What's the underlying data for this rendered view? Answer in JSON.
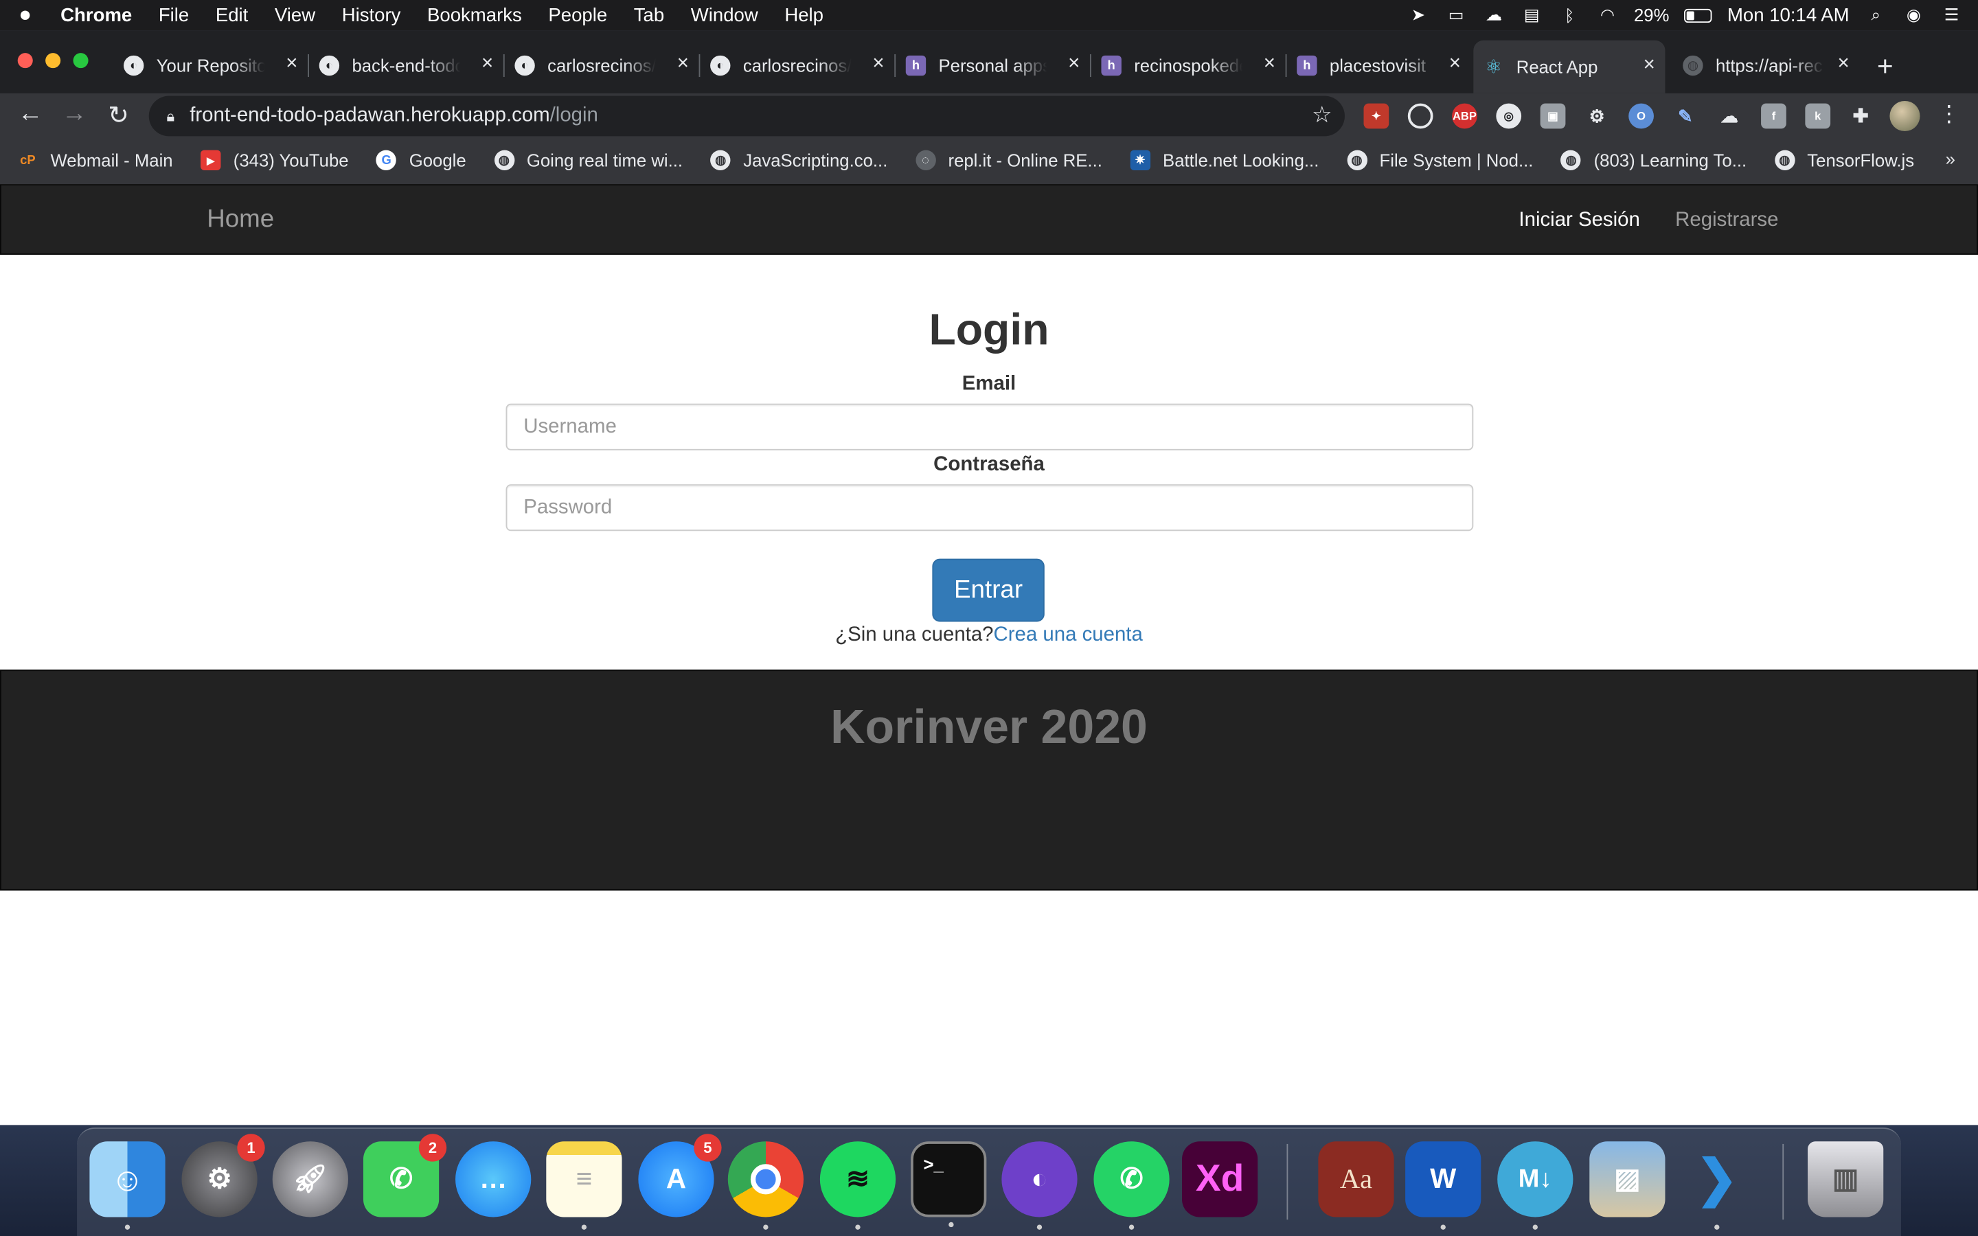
{
  "menubar": {
    "app_name": "Chrome",
    "items": [
      "File",
      "Edit",
      "View",
      "History",
      "Bookmarks",
      "People",
      "Tab",
      "Window",
      "Help"
    ],
    "battery_percent": "29%",
    "clock": "Mon 10:14 AM"
  },
  "browser": {
    "tabs": [
      {
        "title": "Your Repositories",
        "icon": "github-icon"
      },
      {
        "title": "back-end-todo",
        "icon": "github-icon"
      },
      {
        "title": "carlosrecinos/",
        "icon": "github-icon"
      },
      {
        "title": "carlosrecinos/",
        "icon": "github-icon"
      },
      {
        "title": "Personal apps",
        "icon": "heroku-icon"
      },
      {
        "title": "recinospokedex",
        "icon": "heroku-icon"
      },
      {
        "title": "placestovisit",
        "icon": "heroku-icon"
      },
      {
        "title": "React App",
        "icon": "react-icon",
        "active": true
      },
      {
        "title": "https://api-recinos",
        "icon": "globe-icon"
      }
    ],
    "address": {
      "host": "front-end-todo-padawan.herokuapp.com",
      "path": "/login"
    },
    "bookmarks": [
      {
        "label": "Webmail - Main",
        "icon": "cpanel-icon"
      },
      {
        "label": "(343) YouTube",
        "icon": "youtube-icon"
      },
      {
        "label": "Google",
        "icon": "google-icon"
      },
      {
        "label": "Going real time wi...",
        "icon": "globe-icon"
      },
      {
        "label": "JavaScripting.co...",
        "icon": "globe-icon"
      },
      {
        "label": "repl.it - Online RE...",
        "icon": "replit-icon"
      },
      {
        "label": "Battle.net Looking...",
        "icon": "battlenet-icon"
      },
      {
        "label": "File System | Nod...",
        "icon": "globe-icon"
      },
      {
        "label": "(803) Learning To...",
        "icon": "globe-icon"
      },
      {
        "label": "TensorFlow.js",
        "icon": "globe-icon"
      }
    ],
    "bookmarks_more": "»"
  },
  "site": {
    "nav": {
      "brand": "Home",
      "login": "Iniciar Sesión",
      "register": "Registrarse"
    },
    "login": {
      "title": "Login",
      "email_label": "Email",
      "email_placeholder": "Username",
      "password_label": "Contraseña",
      "password_placeholder": "Password",
      "submit": "Entrar",
      "signup_prompt": "¿Sin una cuenta?",
      "signup_link": "Crea una cuenta"
    },
    "footer": "Korinver 2020"
  },
  "dock": {
    "apps": [
      {
        "name": "Finder",
        "badge": ""
      },
      {
        "name": "System Preferences",
        "badge": "1"
      },
      {
        "name": "Launchpad",
        "badge": ""
      },
      {
        "name": "FaceTime",
        "badge": "2"
      },
      {
        "name": "Messages",
        "badge": ""
      },
      {
        "name": "Notes",
        "badge": ""
      },
      {
        "name": "App Store",
        "badge": "5"
      },
      {
        "name": "Chrome",
        "badge": ""
      },
      {
        "name": "Spotify",
        "badge": ""
      },
      {
        "name": "Terminal",
        "badge": ""
      },
      {
        "name": "GitHub Desktop",
        "badge": ""
      },
      {
        "name": "WhatsApp",
        "badge": ""
      },
      {
        "name": "Adobe XD",
        "badge": ""
      },
      {
        "name": "Dictionary",
        "badge": ""
      },
      {
        "name": "Microsoft Word",
        "badge": ""
      },
      {
        "name": "Markdown",
        "badge": ""
      },
      {
        "name": "Preview",
        "badge": ""
      },
      {
        "name": "VS Code",
        "badge": ""
      },
      {
        "name": "Trash",
        "badge": ""
      }
    ]
  }
}
